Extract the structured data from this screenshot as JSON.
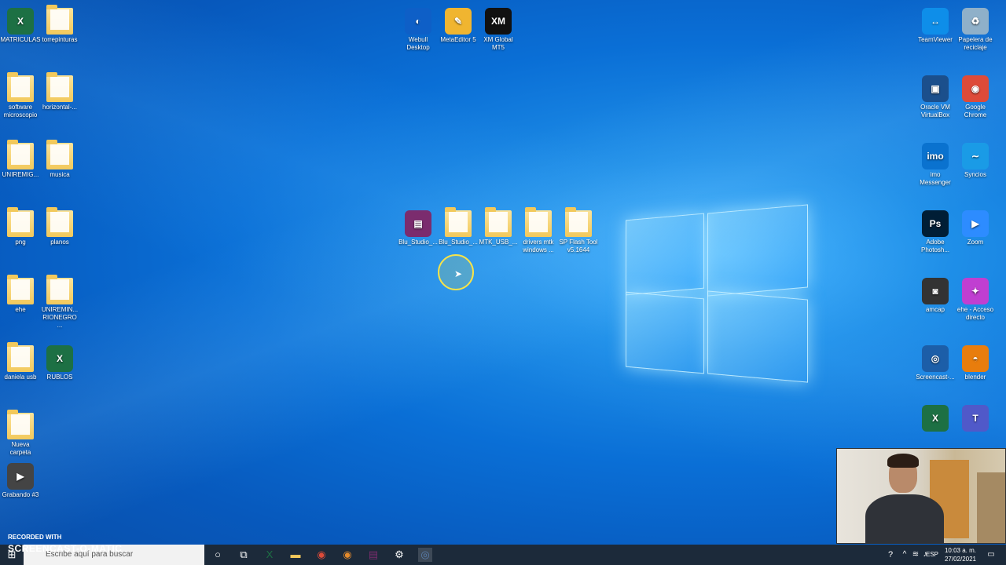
{
  "desktop": {
    "left_icons": [
      {
        "label": "MATRICULAS",
        "type": "excel-file",
        "col": 0,
        "row": 0
      },
      {
        "label": "torrepinturas",
        "type": "folder",
        "col": 1,
        "row": 0
      },
      {
        "label": "software microscopio",
        "type": "folder",
        "col": 0,
        "row": 1
      },
      {
        "label": "horizontal-...",
        "type": "folder",
        "col": 1,
        "row": 1
      },
      {
        "label": "UNIREMIG...",
        "type": "folder",
        "col": 0,
        "row": 2
      },
      {
        "label": "musica",
        "type": "folder",
        "col": 1,
        "row": 2
      },
      {
        "label": "png",
        "type": "folder",
        "col": 0,
        "row": 3
      },
      {
        "label": "planos",
        "type": "folder",
        "col": 1,
        "row": 3
      },
      {
        "label": "ehe",
        "type": "folder",
        "col": 0,
        "row": 4
      },
      {
        "label": "UNIREMIN... RIONEGRO ...",
        "type": "folder",
        "col": 1,
        "row": 4
      },
      {
        "label": "daniela usb",
        "type": "folder",
        "col": 0,
        "row": 5
      },
      {
        "label": "RUBLOS",
        "type": "excel-file",
        "col": 1,
        "row": 5
      },
      {
        "label": "Nueva carpeta",
        "type": "folder",
        "col": 0,
        "row": 6
      },
      {
        "label": "Grabando #3",
        "type": "video-file",
        "col": 0,
        "row": 7
      }
    ],
    "top_icons": [
      {
        "label": "Webull Desktop",
        "type": "webull-icon"
      },
      {
        "label": "MetaEditor 5",
        "type": "metaeditor-icon"
      },
      {
        "label": "XM Global MT5",
        "type": "xm-icon"
      }
    ],
    "middle_icons": [
      {
        "label": "Blu_Studio_...",
        "type": "winrar-icon"
      },
      {
        "label": "Blu_Studio_...",
        "type": "folder"
      },
      {
        "label": "MTK_USB_...",
        "type": "folder"
      },
      {
        "label": "drivers mtk windows ...",
        "type": "folder"
      },
      {
        "label": "SP Flash Tool v5.1644",
        "type": "folder"
      }
    ],
    "right_icons": [
      {
        "label": "TeamViewer",
        "type": "teamviewer-icon",
        "col": 0,
        "row": 0
      },
      {
        "label": "Papelera de reciclaje",
        "type": "recycle-bin-icon",
        "col": 1,
        "row": 0
      },
      {
        "label": "Oracle VM VirtualBox",
        "type": "virtualbox-icon",
        "col": 0,
        "row": 1
      },
      {
        "label": "Google Chrome",
        "type": "chrome-icon",
        "col": 1,
        "row": 1
      },
      {
        "label": "imo Messenger",
        "type": "imo-icon",
        "col": 0,
        "row": 2
      },
      {
        "label": "Syncios",
        "type": "syncios-icon",
        "col": 1,
        "row": 2
      },
      {
        "label": "Adobe Photosh...",
        "type": "photoshop-icon",
        "col": 0,
        "row": 3
      },
      {
        "label": "Zoom",
        "type": "zoom-icon",
        "col": 1,
        "row": 3
      },
      {
        "label": "amcap",
        "type": "camera-icon",
        "col": 0,
        "row": 4
      },
      {
        "label": "ehe - Acceso directo",
        "type": "shortcut-icon",
        "col": 1,
        "row": 4
      },
      {
        "label": "Screencast-...",
        "type": "screencast-icon",
        "col": 0,
        "row": 5
      },
      {
        "label": "blender",
        "type": "blender-icon",
        "col": 1,
        "row": 5
      },
      {
        "label": "",
        "type": "excel-file",
        "col": 0,
        "row": 6
      },
      {
        "label": "",
        "type": "teams-icon",
        "col": 1,
        "row": 6
      }
    ]
  },
  "taskbar": {
    "search_placeholder": "Escribe aquí para buscar",
    "pinned": [
      "cortana-icon",
      "task-view-icon",
      "excel-icon",
      "file-explorer-icon",
      "chrome-icon",
      "chrome-alt-icon",
      "winrar-icon",
      "settings-icon",
      "screencast-icon"
    ],
    "tray_lang": "ESP",
    "time": "10:03 a. m.",
    "date": "27/02/2021"
  },
  "watermark": {
    "line1": "RECORDED WITH",
    "line2": "SCREENCAST-O-MATIC"
  }
}
